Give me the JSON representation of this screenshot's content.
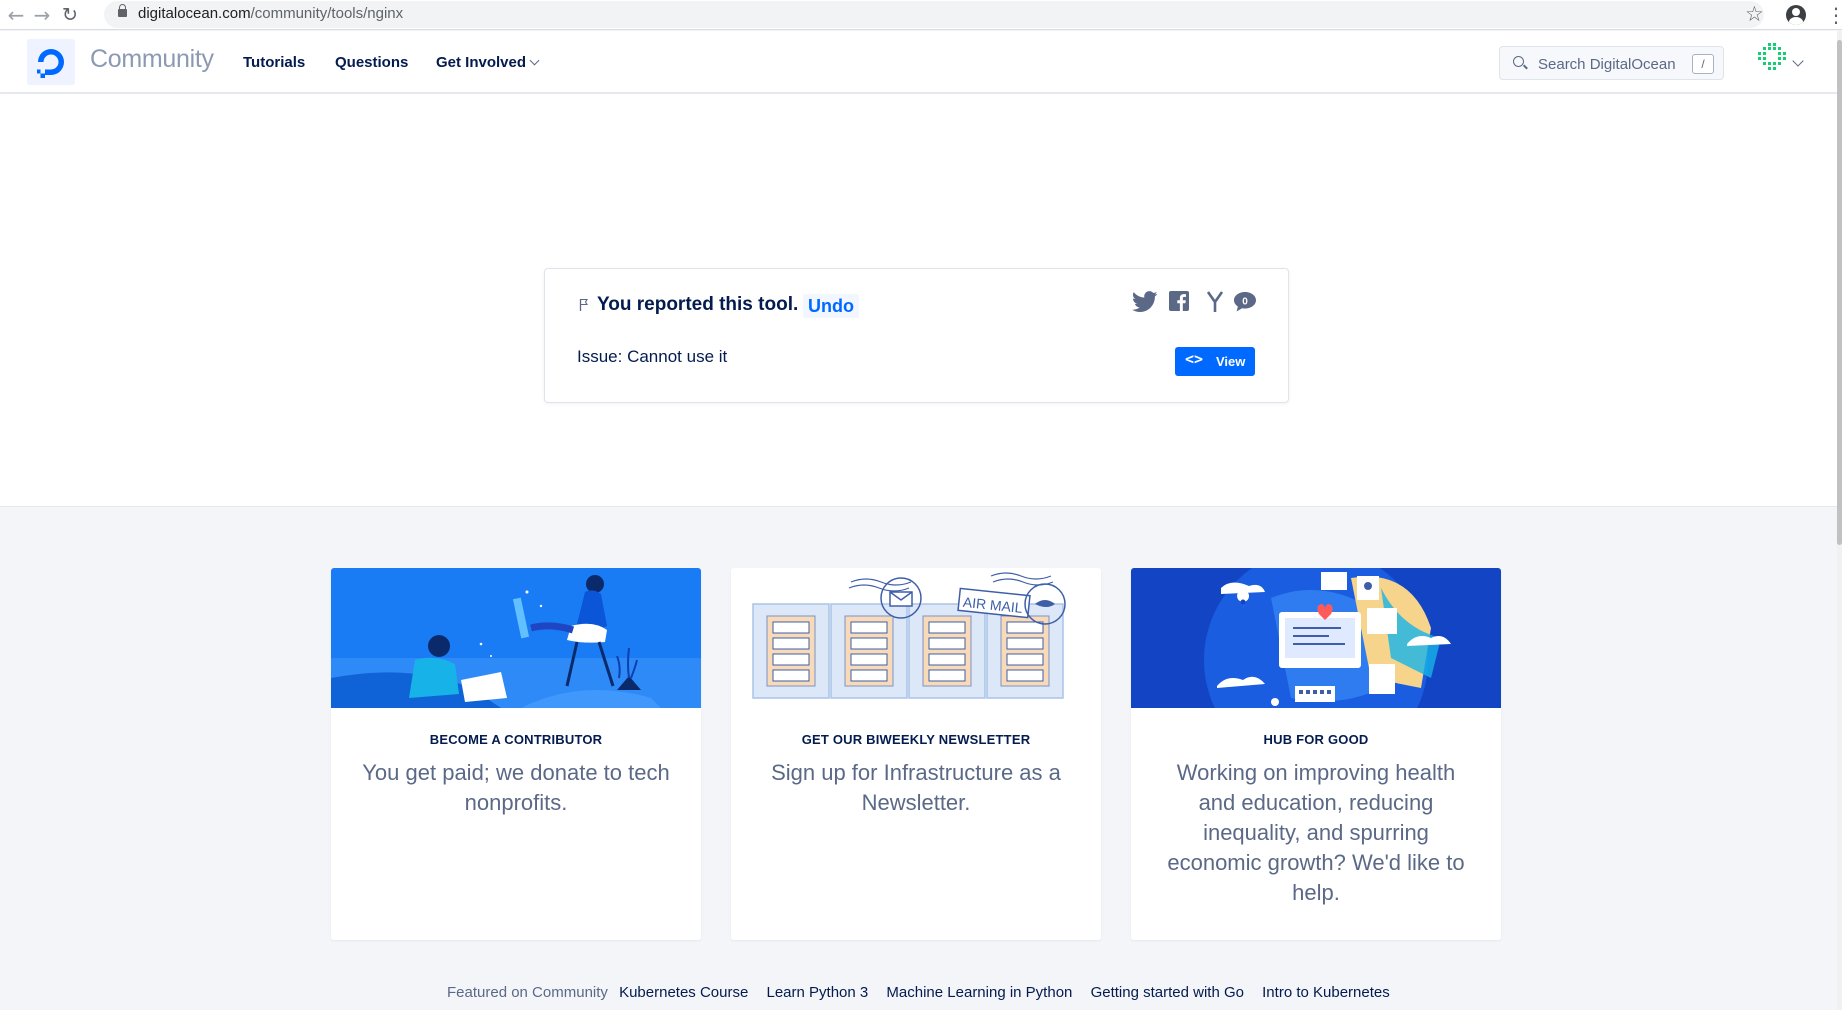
{
  "browser": {
    "url_domain": "digitalocean.com",
    "url_path": "/community/tools/nginx",
    "back_icon": "arrow-left",
    "forward_icon": "arrow-right",
    "reload_icon": "reload"
  },
  "header": {
    "brand": "Community",
    "nav": [
      {
        "label": "Tutorials"
      },
      {
        "label": "Questions"
      },
      {
        "label": "Get Involved"
      }
    ],
    "search_placeholder": "Search DigitalOcean",
    "search_shortcut": "/"
  },
  "report": {
    "title": "You reported this tool.",
    "undo_label": "Undo",
    "issue": "Issue: Cannot use it",
    "comment_count": "0",
    "view_label": "View",
    "view_icon": "<>"
  },
  "cards": [
    {
      "heading": "BECOME A CONTRIBUTOR",
      "body": "You get paid; we donate to tech nonprofits."
    },
    {
      "heading": "GET OUR BIWEEKLY NEWSLETTER",
      "body": "Sign up for Infrastructure as a Newsletter."
    },
    {
      "heading": "HUB FOR GOOD",
      "body": "Working on improving health and education, reducing inequality, and spurring economic growth? We'd like to help."
    }
  ],
  "newsletter_stamp_text": "AIR MAIL",
  "featured": {
    "label": "Featured on Community",
    "links": [
      "Kubernetes Course",
      "Learn Python 3",
      "Machine Learning in Python",
      "Getting started with Go",
      "Intro to Kubernetes"
    ]
  },
  "colors": {
    "brand_blue": "#0069ff",
    "navy": "#031b4e",
    "muted": "#5b6987"
  }
}
